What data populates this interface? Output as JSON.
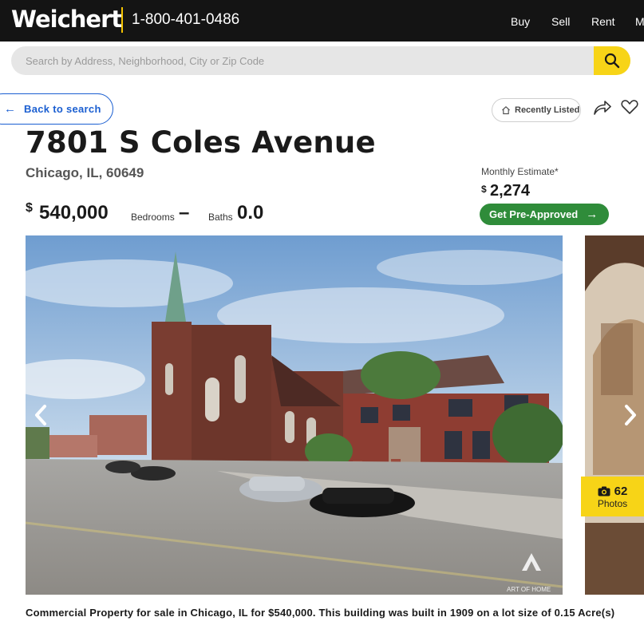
{
  "header": {
    "logo": "Weichert",
    "phone": "1-800-401-0486",
    "nav": [
      "Buy",
      "Sell",
      "Rent",
      "M"
    ]
  },
  "search": {
    "placeholder": "Search by Address, Neighborhood, City or Zip Code",
    "value": ""
  },
  "back_link": {
    "label": "Back to search"
  },
  "badge": {
    "label": "Recently Listed"
  },
  "listing": {
    "title": "7801 S Coles Avenue",
    "location": "Chicago, IL, 60649",
    "currency_symbol": "$",
    "price": "540,000",
    "bedrooms_label": "Bedrooms",
    "bedrooms_value": "–",
    "baths_label": "Baths",
    "baths_value": "0.0"
  },
  "estimate": {
    "label": "Monthly Estimate*",
    "currency_symbol": "$",
    "value": "2,274",
    "cta": "Get Pre-Approved"
  },
  "gallery": {
    "photo_count": "62",
    "photo_label": "Photos",
    "watermark": "ART OF HOME"
  },
  "description": "Commercial Property for sale in Chicago, IL for $540,000. This building was built in 1909 on a lot size of 0.15 Acre(s)",
  "colors": {
    "header_bg": "#141414",
    "accent_yellow": "#f7d417",
    "link_blue": "#1b5fd1",
    "cta_green": "#2f8c3a"
  },
  "icons": [
    "search-icon",
    "arrow-left-icon",
    "home-icon",
    "share-icon",
    "heart-icon",
    "chevron-left-icon",
    "chevron-right-icon",
    "camera-icon",
    "arrow-right-icon"
  ]
}
